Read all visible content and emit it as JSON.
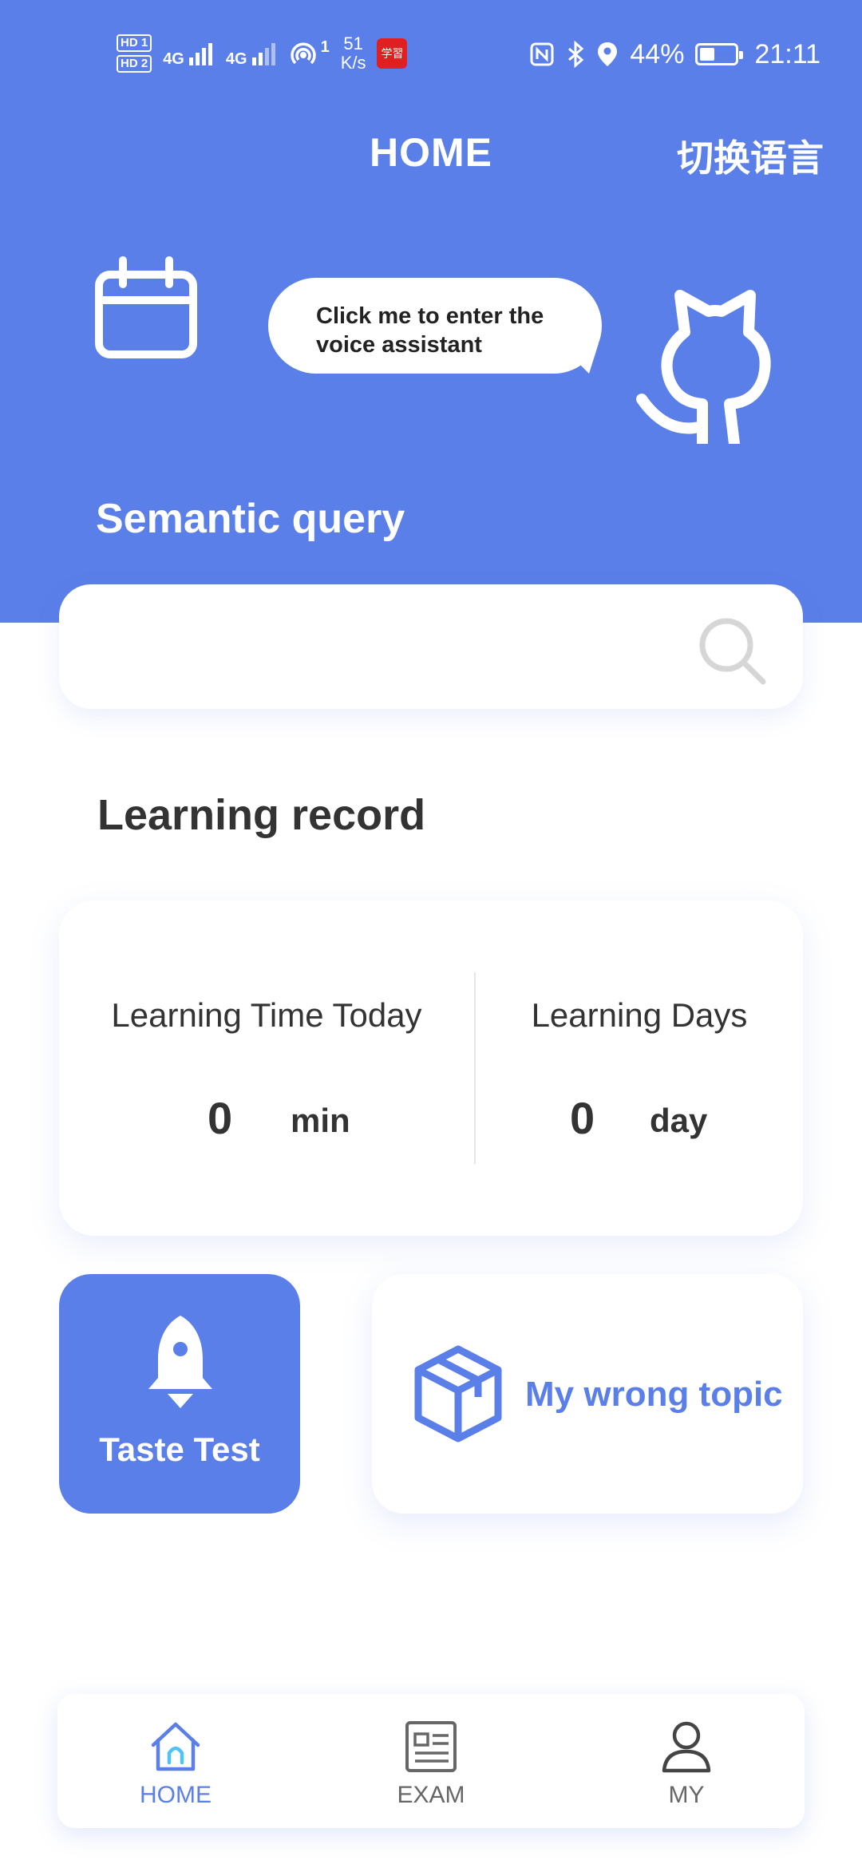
{
  "status_bar": {
    "hd1": "HD 1",
    "hd2": "HD 2",
    "net1": "4G",
    "net2": "4G",
    "hotspot_count": "1",
    "speed_value": "51",
    "speed_unit": "K/s",
    "app_badge": "学習",
    "battery": "44%",
    "battery_level": 0.44,
    "time": "21:11"
  },
  "header": {
    "title": "HOME",
    "language_switch": "切换语言"
  },
  "voice": {
    "bubble_text_line1": "Click me to enter the",
    "bubble_text_line2": "voice assistant"
  },
  "search": {
    "label": "Semantic query",
    "value": "",
    "placeholder": ""
  },
  "record": {
    "section_title": "Learning record",
    "time_label": "Learning Time Today",
    "time_value": "0",
    "time_unit": "min",
    "days_label": "Learning Days",
    "days_value": "0",
    "days_unit": "day"
  },
  "cards": {
    "taste_test": "Taste Test",
    "wrong_topic": "My wrong topic"
  },
  "tabs": [
    {
      "label": "HOME",
      "icon": "home-icon",
      "active": true
    },
    {
      "label": "EXAM",
      "icon": "exam-icon",
      "active": false
    },
    {
      "label": "MY",
      "icon": "user-icon",
      "active": false
    }
  ],
  "colors": {
    "accent": "#5b7fe8",
    "tab_inactive": "#666666"
  }
}
